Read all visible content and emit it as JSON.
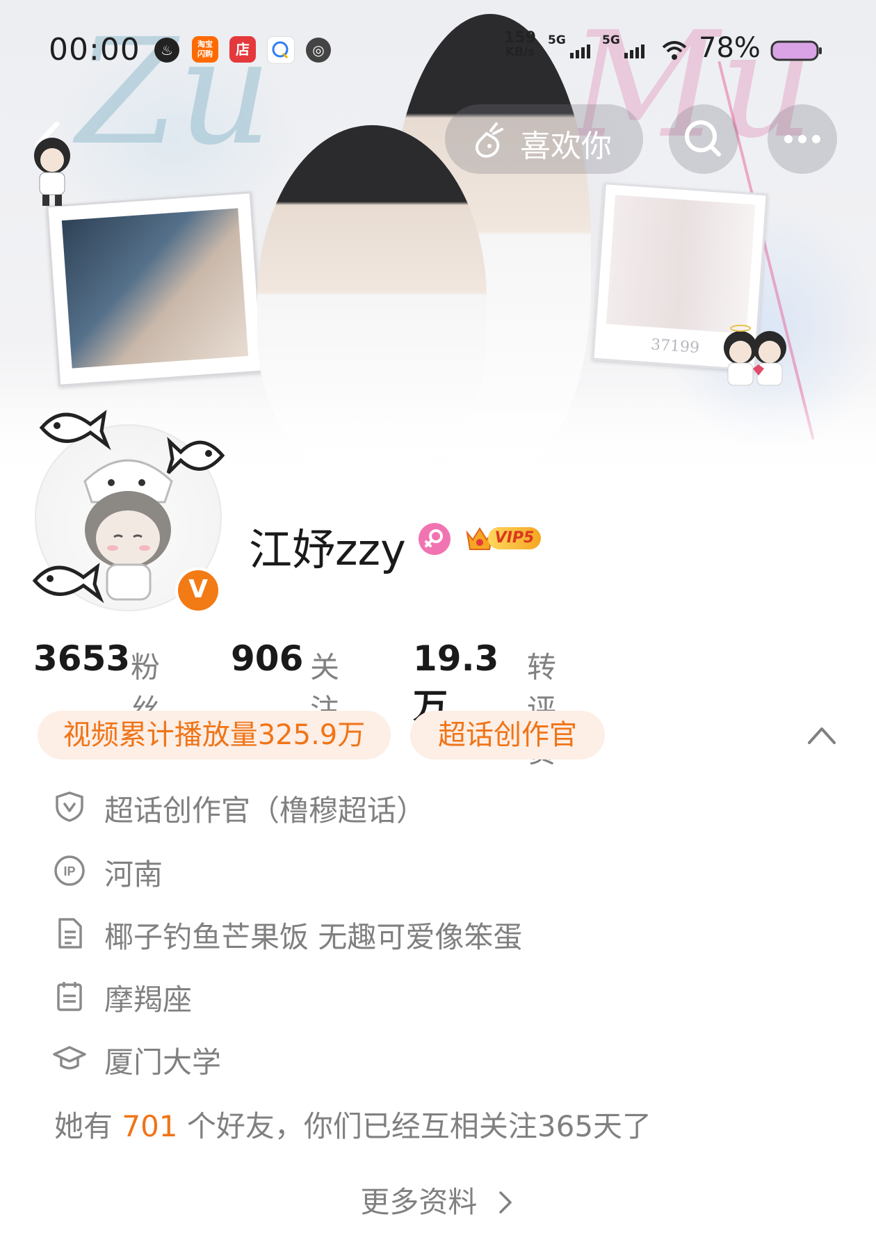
{
  "status_bar": {
    "time": "00:00",
    "app_icons": [
      {
        "name": "taobao-flash-icon",
        "label": "淘宝闪购",
        "color": "#ff6a00"
      },
      {
        "name": "store-icon",
        "label": "店",
        "color": "#e4393c"
      },
      {
        "name": "chat-icon",
        "label": "",
        "color": "#2e7cf6"
      }
    ],
    "net_speed_value": "159",
    "net_speed_unit": "KB/s",
    "signal_1": "5G",
    "signal_2": "5G",
    "battery": "78%"
  },
  "header": {
    "back_label": "",
    "like_button": "喜欢你",
    "icons": [
      "back-arrow-icon",
      "carrot-heart-icon",
      "search-icon",
      "more-dots-icon"
    ]
  },
  "banner": {
    "script_left": "Zu",
    "script_right": "Mu",
    "polaroid_caption": "37199"
  },
  "profile": {
    "username": "江妤zzy",
    "vip_label": "VIP5",
    "verified_mark": "V",
    "stats": [
      {
        "value": "3653",
        "label": "粉丝"
      },
      {
        "value": "906",
        "label": "关注"
      },
      {
        "value": "19.3万",
        "label": "转评赞"
      }
    ],
    "tags": [
      "视频累计播放量325.9万",
      "超话创作官"
    ],
    "info": [
      {
        "icon": "shield-v-icon",
        "text": "超话创作官（橹穆超话）"
      },
      {
        "icon": "ip-icon",
        "text": "河南"
      },
      {
        "icon": "document-icon",
        "text": "椰子钓鱼芒果饭 无趣可爱像笨蛋"
      },
      {
        "icon": "calendar-icon",
        "text": "摩羯座"
      },
      {
        "icon": "graduation-cap-icon",
        "text": "厦门大学"
      }
    ],
    "friends": {
      "prefix": "她有 ",
      "count": "701",
      "suffix": " 个好友，你们已经互相关注365天了"
    },
    "more_label": "更多资料"
  },
  "colors": {
    "accent_orange": "#f07417",
    "tag_bg": "#fdeee6",
    "text_gray": "#808080",
    "gender_pink": "#f174b2"
  }
}
